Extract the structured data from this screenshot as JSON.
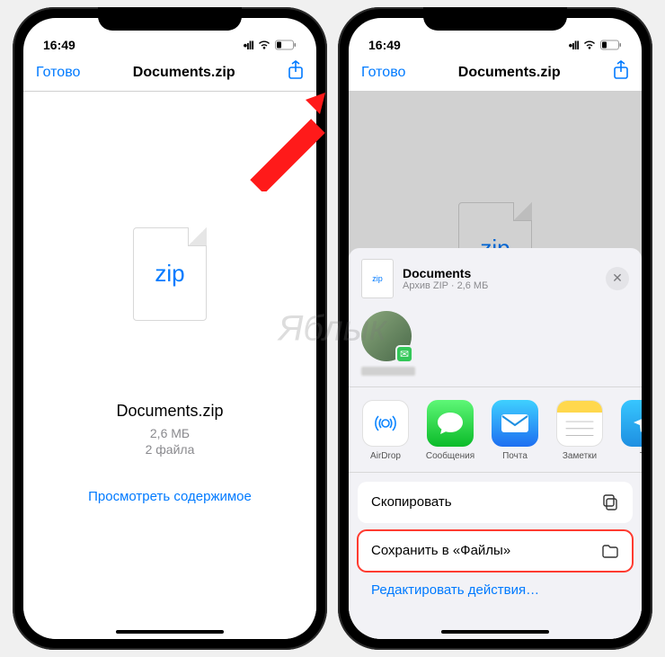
{
  "status": {
    "time": "16:49"
  },
  "nav": {
    "done": "Готово",
    "title": "Documents.zip"
  },
  "file": {
    "icon_label": "zip",
    "name": "Documents.zip",
    "size": "2,6 МБ",
    "count": "2 файла",
    "view_contents": "Просмотреть содержимое"
  },
  "sheet": {
    "title": "Documents",
    "subtitle": "Архив ZIP · 2,6 МБ",
    "thumb_label": "zip",
    "apps": {
      "airdrop": "AirDrop",
      "messages": "Сообщения",
      "mail": "Почта",
      "notes": "Заметки",
      "telegram": "Te"
    },
    "actions": {
      "copy": "Скопировать",
      "save_files": "Сохранить в «Файлы»",
      "edit": "Редактировать действия…"
    }
  },
  "watermark": "Яблык"
}
